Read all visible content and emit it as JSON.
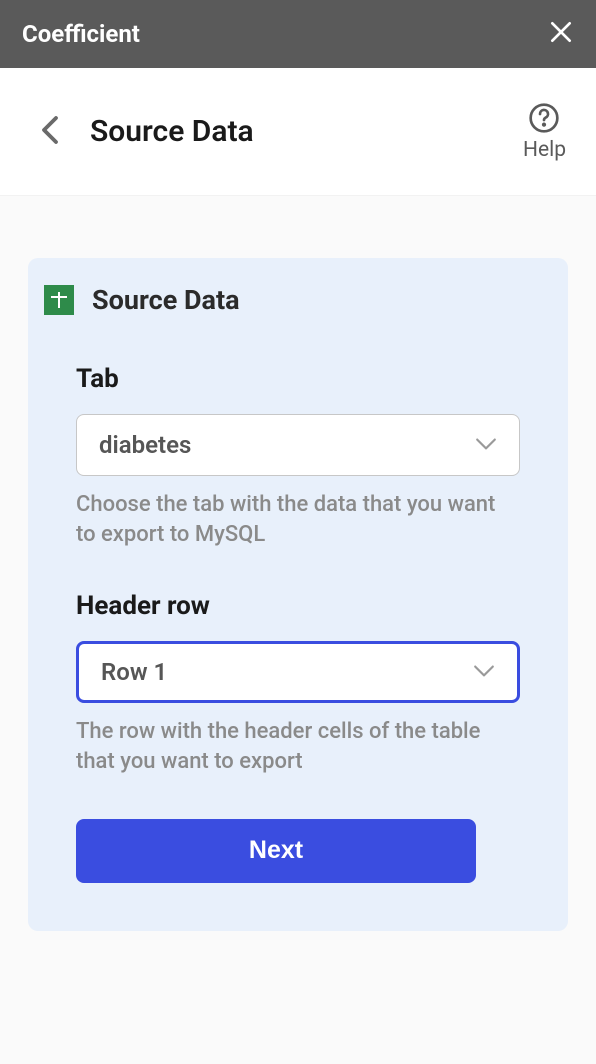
{
  "titlebar": {
    "title": "Coefficient"
  },
  "header": {
    "page_title": "Source Data",
    "help_label": "Help"
  },
  "card": {
    "title": "Source Data",
    "tab_section": {
      "label": "Tab",
      "value": "diabetes",
      "helper": "Choose the tab with the data that you want to export to MySQL"
    },
    "header_row_section": {
      "label": "Header row",
      "value": "Row 1",
      "helper": "The row with the header cells of the table that you want to export"
    },
    "next_label": "Next"
  }
}
